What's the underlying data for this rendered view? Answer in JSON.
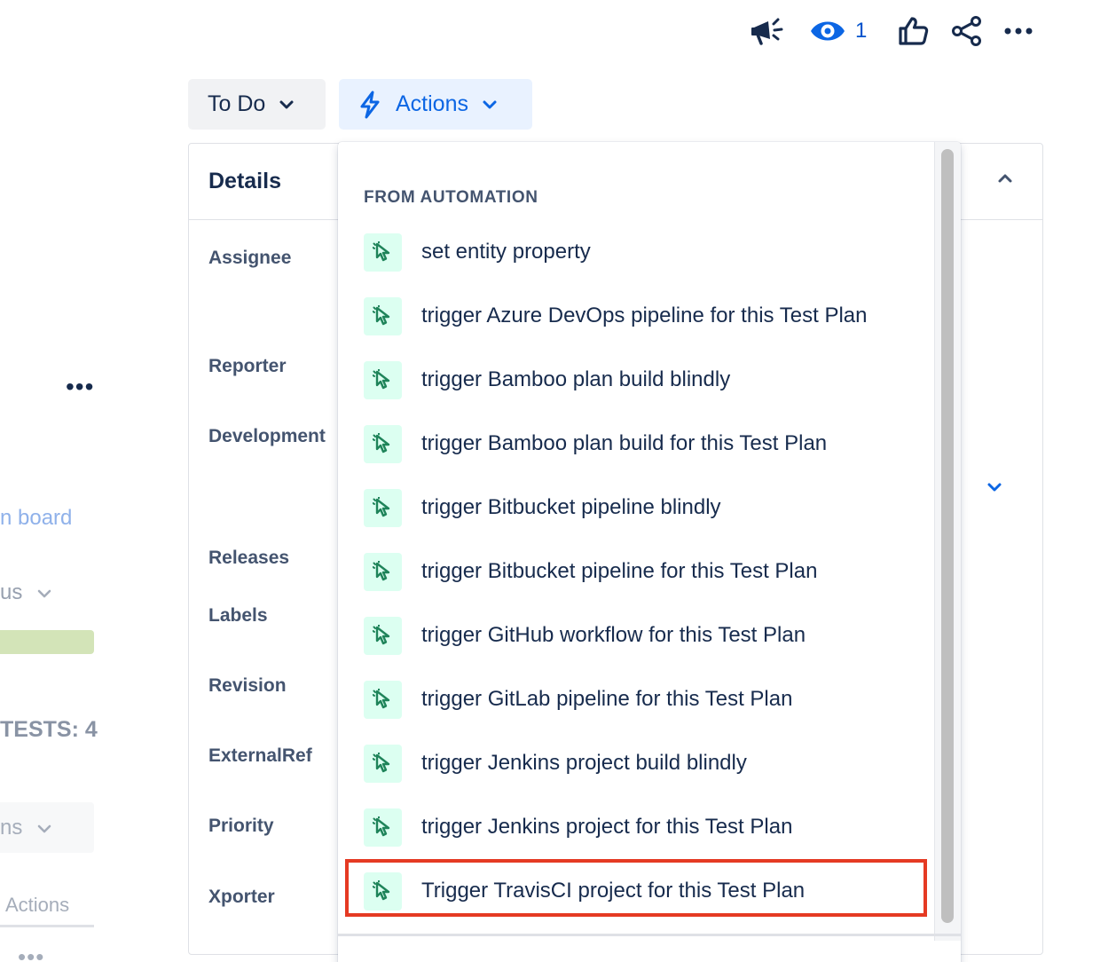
{
  "toolbar": {
    "announce_icon": "megaphone-icon",
    "watch_icon": "eye-icon",
    "watch_count": "1",
    "like_icon": "thumbs-up-icon",
    "share_icon": "share-icon",
    "more_icon": "more-horizontal-icon",
    "eye_color": "#0c66e4"
  },
  "status_button": {
    "label": "To Do"
  },
  "actions_button": {
    "label": "Actions",
    "icon": "lightning-bolt-icon",
    "color": "#0c66e4"
  },
  "details": {
    "title": "Details",
    "fields": [
      {
        "label": "Assignee"
      },
      {
        "label": "Reporter"
      },
      {
        "label": "Development"
      },
      {
        "label": "Releases"
      },
      {
        "label": "Labels"
      },
      {
        "label": "Revision"
      },
      {
        "label": "ExternalRef"
      },
      {
        "label": "Priority"
      },
      {
        "label": "Xporter"
      }
    ]
  },
  "left_panel": {
    "more": "•••",
    "board_link": "n board",
    "status_text": "us",
    "tests_text": "TESTS: 4",
    "select_text": "ns",
    "actions_tab": "Actions",
    "more_bottom": "•••"
  },
  "dropdown": {
    "section_heading": "FROM AUTOMATION",
    "item_icon": "automation-cursor-icon",
    "items": [
      {
        "label": "set entity property"
      },
      {
        "label": "trigger Azure DevOps pipeline for this Test Plan"
      },
      {
        "label": "trigger Bamboo plan build blindly"
      },
      {
        "label": "trigger Bamboo plan build for this Test Plan"
      },
      {
        "label": "trigger Bitbucket pipeline blindly"
      },
      {
        "label": "trigger Bitbucket pipeline for this Test Plan"
      },
      {
        "label": "trigger GitHub workflow for this Test Plan"
      },
      {
        "label": "trigger GitLab pipeline for this Test Plan"
      },
      {
        "label": "trigger Jenkins project build blindly"
      },
      {
        "label": "trigger Jenkins project for this Test Plan"
      },
      {
        "label": "Trigger TravisCI project for this Test Plan"
      }
    ],
    "highlight_color": "#e53a23"
  }
}
